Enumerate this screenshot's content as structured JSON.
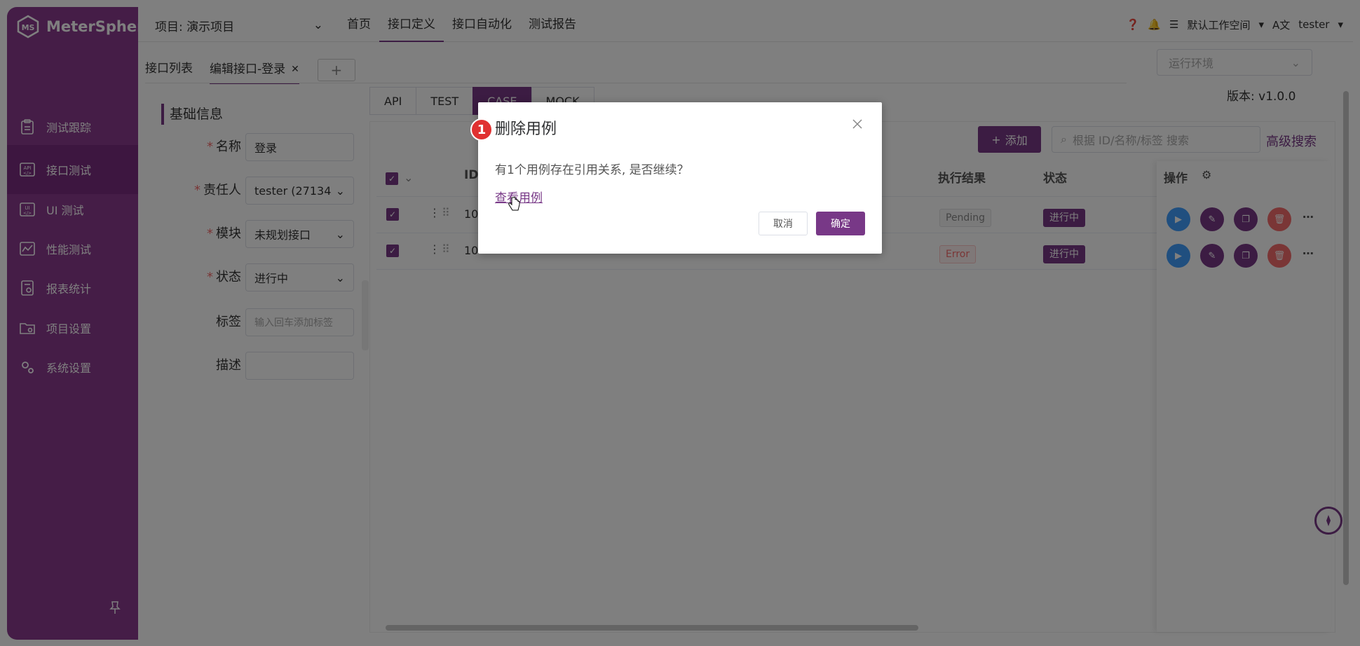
{
  "app": {
    "name": "MeterSphere"
  },
  "sidebar": {
    "items": [
      {
        "label": "测试跟踪",
        "icon": "clipboard-icon"
      },
      {
        "label": "接口测试",
        "icon": "api-icon",
        "active": true
      },
      {
        "label": "UI 测试",
        "icon": "ui-icon"
      },
      {
        "label": "性能测试",
        "icon": "chart-icon"
      },
      {
        "label": "报表统计",
        "icon": "report-icon"
      },
      {
        "label": "项目设置",
        "icon": "folder-gear-icon"
      },
      {
        "label": "系统设置",
        "icon": "gears-icon"
      }
    ]
  },
  "header": {
    "project": "项目: 演示项目",
    "tabs": [
      "首页",
      "接口定义",
      "接口自动化",
      "测试报告"
    ],
    "workspace": "默认工作空间",
    "user": "tester"
  },
  "editor": {
    "tabs": [
      "接口列表",
      "编辑接口-登录"
    ],
    "plus": "+",
    "env_placeholder": "运行环境",
    "version": "版本: v1.0.0"
  },
  "form": {
    "title": "基础信息",
    "name_label": "名称",
    "name_value": "登录",
    "owner_label": "责任人",
    "owner_value": "tester (27134",
    "module_label": "模块",
    "module_value": "未规划接口",
    "status_label": "状态",
    "status_value": "进行中",
    "tag_label": "标签",
    "tag_placeholder": "输入回车添加标签",
    "desc_label": "描述"
  },
  "type_tabs": [
    "API",
    "TEST",
    "CASE",
    "MOCK"
  ],
  "table": {
    "add_label": "添加",
    "search_placeholder": "根据 ID/名称/标签 搜索",
    "advanced_search": "高级搜索",
    "columns": {
      "id": "ID",
      "result": "执行结果",
      "status": "状态",
      "ops": "操作"
    },
    "rows": [
      {
        "id": "10",
        "result": "Pending",
        "status": "进行中"
      },
      {
        "id": "10",
        "result": "Error",
        "status": "进行中"
      }
    ]
  },
  "dialog": {
    "badge": "1",
    "title": "删除用例",
    "message": "有1个用例存在引用关系, 是否继续？",
    "link": "查看用例",
    "cancel": "取消",
    "confirm": "确定"
  },
  "colors": {
    "brand": "#783887",
    "sidebar": "#8a3a8f",
    "error": "#f56c6c"
  }
}
